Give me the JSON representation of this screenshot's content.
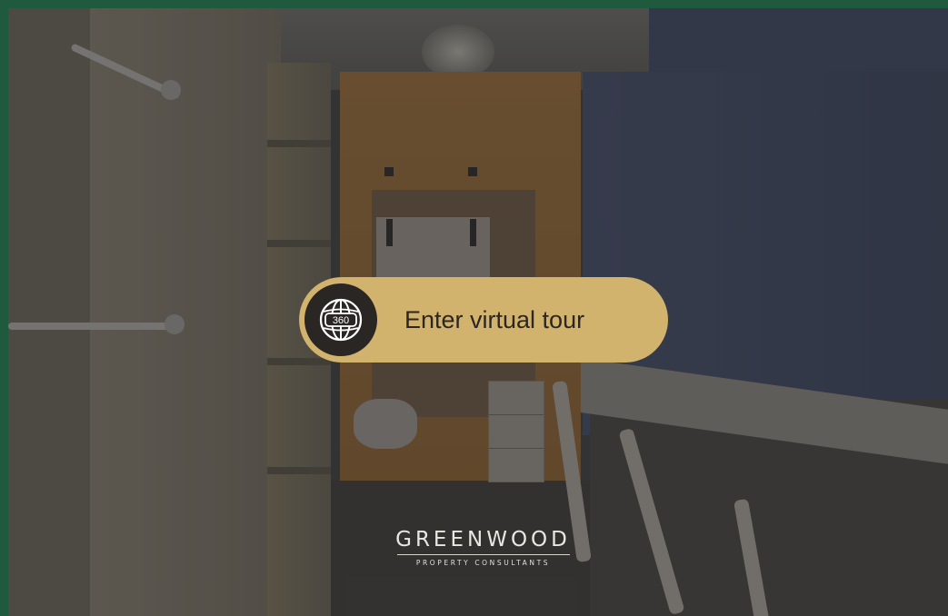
{
  "frame": {
    "border_color": "#1f5a3e"
  },
  "cta": {
    "icon": "360-globe-icon",
    "icon_text": "360",
    "label": "Enter virtual tour",
    "background": "#d2b36e"
  },
  "logo": {
    "name": "GREENWOOD",
    "tagline": "PROPERTY CONSULTANTS"
  }
}
